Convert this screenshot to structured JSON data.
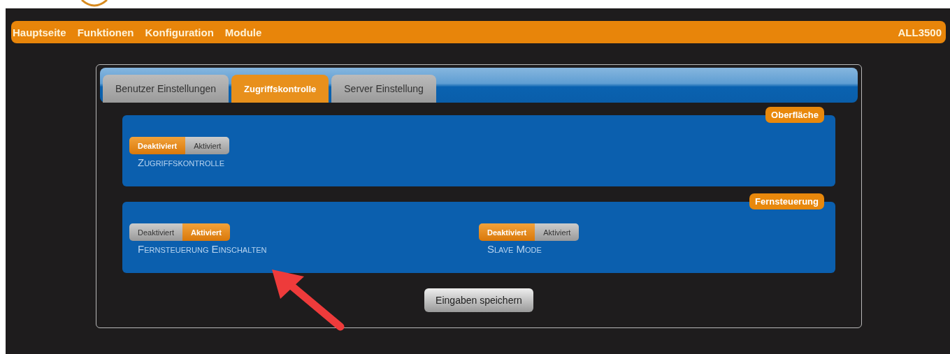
{
  "navbar": {
    "items": [
      {
        "label": "Hauptseite"
      },
      {
        "label": "Funktionen"
      },
      {
        "label": "Konfiguration"
      },
      {
        "label": "Module"
      }
    ],
    "device": "ALL3500"
  },
  "tabs": [
    {
      "label": "Benutzer Einstellungen",
      "selected": false
    },
    {
      "label": "Zugriffskontrolle",
      "selected": true
    },
    {
      "label": "Server Einstellung",
      "selected": false
    }
  ],
  "sections": [
    {
      "legend": "Oberfläche",
      "fields": [
        {
          "label": "Zugriffskontrolle",
          "options": [
            {
              "label": "Deaktiviert",
              "selected": true
            },
            {
              "label": "Aktiviert",
              "selected": false
            }
          ]
        }
      ]
    },
    {
      "legend": "Fernsteuerung",
      "fields": [
        {
          "label": "Fernsteuerung Einschalten",
          "options": [
            {
              "label": "Deaktiviert",
              "selected": false
            },
            {
              "label": "Aktiviert",
              "selected": true
            }
          ]
        },
        {
          "label": "Slave Mode",
          "options": [
            {
              "label": "Deaktiviert",
              "selected": true
            },
            {
              "label": "Aktiviert",
              "selected": false
            }
          ]
        }
      ]
    }
  ],
  "save_button": "Eingaben speichern"
}
